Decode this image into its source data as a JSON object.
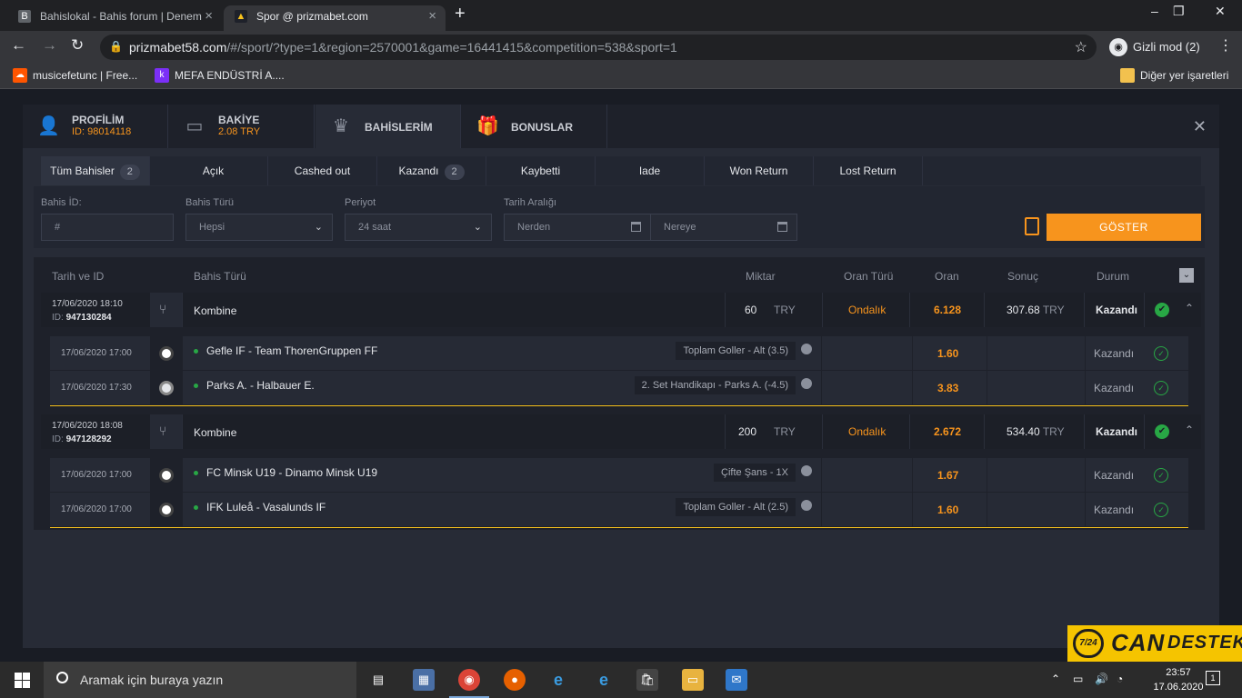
{
  "browser": {
    "tabs": [
      {
        "title": "Bahislokal - Bahis forum | Denem",
        "favicon": "B"
      },
      {
        "title": "Spor @ prizmabet.com",
        "favicon": "S"
      }
    ],
    "new_tab": "+",
    "window_controls": [
      "–",
      "❐",
      "✕"
    ],
    "address": {
      "domain": "prizmabet58.com",
      "path": "/#/sport/?type=1&region=2570001&game=16441415&competition=538&sport=1"
    },
    "incognito_label": "Gizli mod (2)",
    "bookmarks": [
      {
        "label": "musicefetunc | Free...",
        "icon": "soundcloud-icon",
        "color": "#ff5500"
      },
      {
        "label": "MEFA ENDÜSTRİ A....",
        "icon": "k-icon",
        "color": "#7b2ff7"
      }
    ],
    "other_bookmarks": "Diğer yer işaretleri"
  },
  "modal": {
    "tabs": [
      {
        "label": "PROFİLİM",
        "sub": "ID: 98014118",
        "icon": "user-icon"
      },
      {
        "label": "BAKİYE",
        "sub": "2.08 TRY",
        "icon": "wallet-icon"
      },
      {
        "label": "BAHİSLERİM",
        "sub": "",
        "icon": "trophy-icon"
      },
      {
        "label": "BONUSLAR",
        "sub": "",
        "icon": "gift-icon"
      }
    ],
    "close": "✕",
    "filter_tabs": [
      {
        "label": "Tüm Bahisler",
        "count": "2"
      },
      {
        "label": "Açık",
        "count": ""
      },
      {
        "label": "Cashed out",
        "count": ""
      },
      {
        "label": "Kazandı",
        "count": "2"
      },
      {
        "label": "Kaybetti",
        "count": ""
      },
      {
        "label": "Iade",
        "count": ""
      },
      {
        "label": "Won Return",
        "count": ""
      },
      {
        "label": "Lost Return",
        "count": ""
      }
    ],
    "filters": {
      "bahis_id_label": "Bahis İD:",
      "bahis_id_placeholder": "#",
      "bahis_turu_label": "Bahis Türü",
      "bahis_turu_value": "Hepsi",
      "periyot_label": "Periyot",
      "periyot_value": "24 saat",
      "tarih_label": "Tarih Aralığı",
      "from_placeholder": "Nerden",
      "to_placeholder": "Nereye",
      "submit": "GÖSTER"
    },
    "table": {
      "headers": [
        "Tarih ve ID",
        "Bahis Türü",
        "Miktar",
        "Oran Türü",
        "Oran",
        "Sonuç",
        "Durum"
      ],
      "bets": [
        {
          "date": "17/06/2020 18:10",
          "id_label": "ID:",
          "id": "947130284",
          "type": "Kombine",
          "amount": "60",
          "currency": "TRY",
          "odds_type": "Ondalık",
          "odds": "6.128",
          "result": "307.68",
          "result_cur": "TRY",
          "status": "Kazandı",
          "selections": [
            {
              "date": "17/06/2020 17:00",
              "match": "Gefle IF - Team ThorenGruppen FF",
              "market": "Toplam Goller - Alt (3.5)",
              "odds": "1.60",
              "status": "Kazandı",
              "sport": "football-icon"
            },
            {
              "date": "17/06/2020 17:30",
              "match": "Parks A. - Halbauer E.",
              "market": "2. Set Handikapı - Parks A. (-4.5)",
              "odds": "3.83",
              "status": "Kazandı",
              "sport": "tennis-icon"
            }
          ]
        },
        {
          "date": "17/06/2020 18:08",
          "id_label": "ID:",
          "id": "947128292",
          "type": "Kombine",
          "amount": "200",
          "currency": "TRY",
          "odds_type": "Ondalık",
          "odds": "2.672",
          "result": "534.40",
          "result_cur": "TRY",
          "status": "Kazandı",
          "selections": [
            {
              "date": "17/06/2020 17:00",
              "match": "FC Minsk U19 - Dinamo Minsk U19",
              "market": "Çifte Şans - 1X",
              "odds": "1.67",
              "status": "Kazandı",
              "sport": "football-icon"
            },
            {
              "date": "17/06/2020 17:00",
              "match": "IFK Luleå - Vasalunds IF",
              "market": "Toplam Goller - Alt (2.5)",
              "odds": "1.60",
              "status": "Kazandı",
              "sport": "football-icon"
            }
          ]
        }
      ]
    }
  },
  "taskbar": {
    "search_placeholder": "Aramak için buraya yazın",
    "time": "23:57",
    "date": "17.06.2020",
    "notifications": "1"
  },
  "badge": {
    "circle": "7/24",
    "word1": "CAN",
    "word2": "DESTEK"
  },
  "colors": {
    "accent": "#f7941d",
    "win": "#28a745",
    "modal_bg": "#272b36"
  }
}
